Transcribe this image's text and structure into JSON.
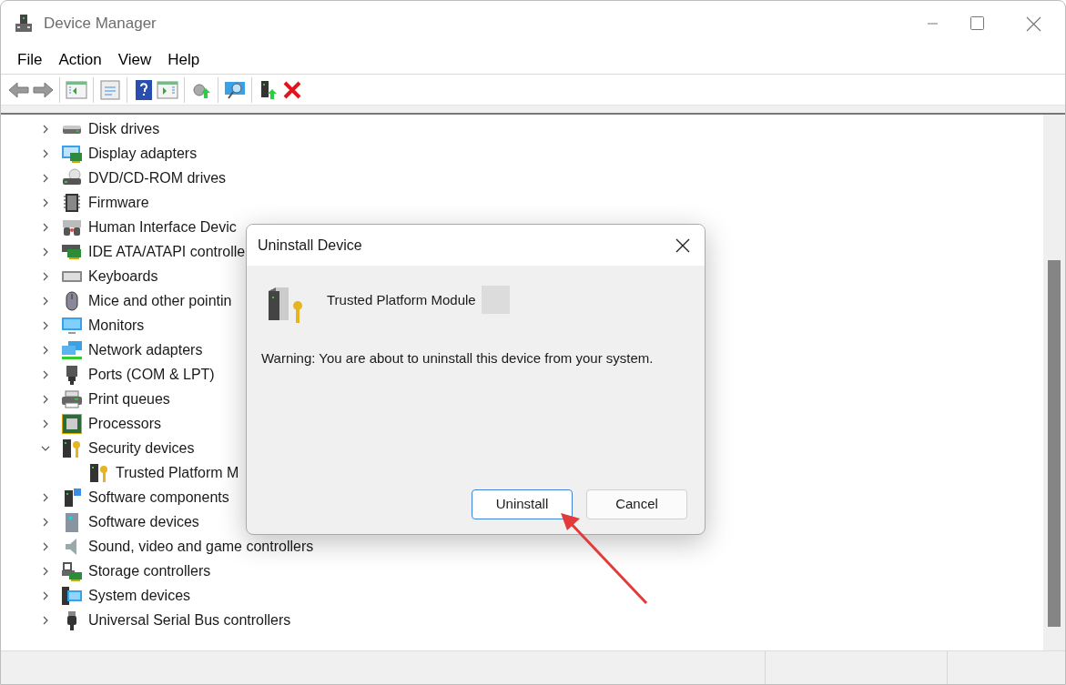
{
  "window": {
    "title": "Device Manager"
  },
  "menu": [
    "File",
    "Action",
    "View",
    "Help"
  ],
  "tree": [
    {
      "label": "Disk drives",
      "kind": "disk",
      "expanded": false
    },
    {
      "label": "Display adapters",
      "kind": "display",
      "expanded": false
    },
    {
      "label": "DVD/CD-ROM drives",
      "kind": "dvd",
      "expanded": false
    },
    {
      "label": "Firmware",
      "kind": "chip",
      "expanded": false
    },
    {
      "label": "Human Interface Devic",
      "kind": "hid",
      "expanded": false
    },
    {
      "label": "IDE ATA/ATAPI controlle",
      "kind": "card",
      "expanded": false
    },
    {
      "label": "Keyboards",
      "kind": "keyboard",
      "expanded": false
    },
    {
      "label": "Mice and other pointin",
      "kind": "mouse",
      "expanded": false
    },
    {
      "label": "Monitors",
      "kind": "monitor",
      "expanded": false
    },
    {
      "label": "Network adapters",
      "kind": "network",
      "expanded": false
    },
    {
      "label": "Ports (COM & LPT)",
      "kind": "port",
      "expanded": false
    },
    {
      "label": "Print queues",
      "kind": "printer",
      "expanded": false
    },
    {
      "label": "Processors",
      "kind": "cpu",
      "expanded": false
    },
    {
      "label": "Security devices",
      "kind": "security",
      "expanded": true,
      "children": [
        {
          "label": "Trusted Platform M",
          "kind": "security"
        }
      ]
    },
    {
      "label": "Software components",
      "kind": "component",
      "expanded": false
    },
    {
      "label": "Software devices",
      "kind": "tower",
      "expanded": false
    },
    {
      "label": "Sound, video and game controllers",
      "kind": "sound",
      "expanded": false
    },
    {
      "label": "Storage controllers",
      "kind": "storage",
      "expanded": false
    },
    {
      "label": "System devices",
      "kind": "system",
      "expanded": false
    },
    {
      "label": "Universal Serial Bus controllers",
      "kind": "usb",
      "expanded": false
    }
  ],
  "dialog": {
    "title": "Uninstall Device",
    "device": "Trusted Platform Module",
    "warning": "Warning: You are about to uninstall this device from your system.",
    "buttons": [
      {
        "label": "Uninstall",
        "default": true
      },
      {
        "label": "Cancel",
        "default": false
      }
    ]
  }
}
